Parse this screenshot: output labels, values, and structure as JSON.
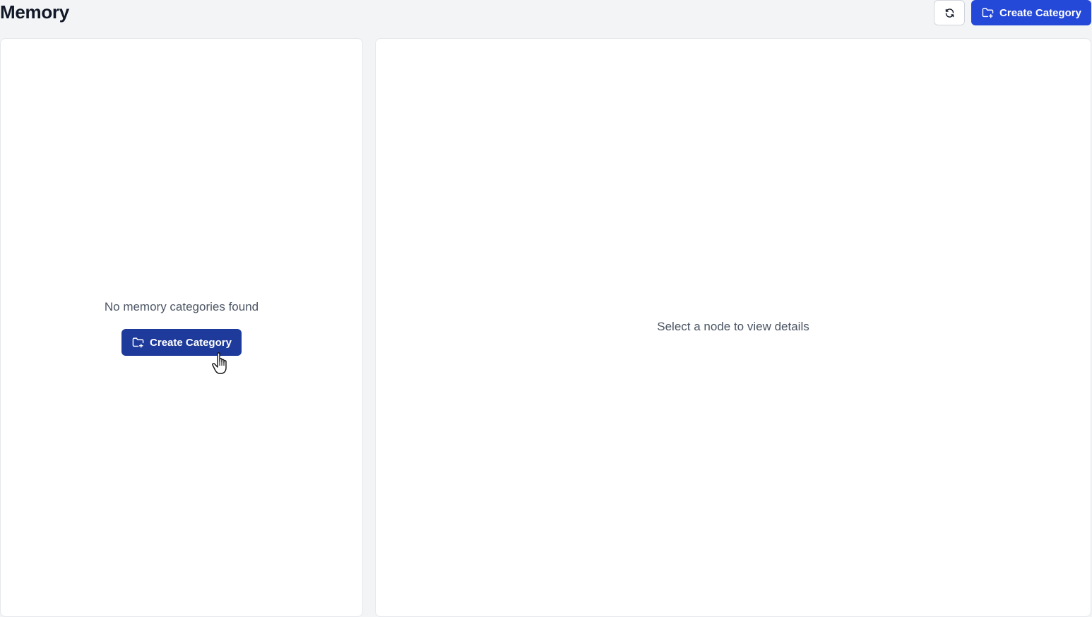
{
  "header": {
    "title": "Memory",
    "refresh_icon": "refresh-icon",
    "create_button_label": "Create Category",
    "create_button_icon": "folder-plus-icon"
  },
  "categories_panel": {
    "empty_message": "No memory categories found",
    "create_button_label": "Create Category",
    "create_button_icon": "folder-plus-icon"
  },
  "details_panel": {
    "empty_message": "Select a node to view details"
  },
  "colors": {
    "primary": "#2448d8",
    "primary_hover": "#1e3a9a",
    "background": "#f3f4f6",
    "panel": "#ffffff",
    "muted_text": "#4b5563"
  }
}
